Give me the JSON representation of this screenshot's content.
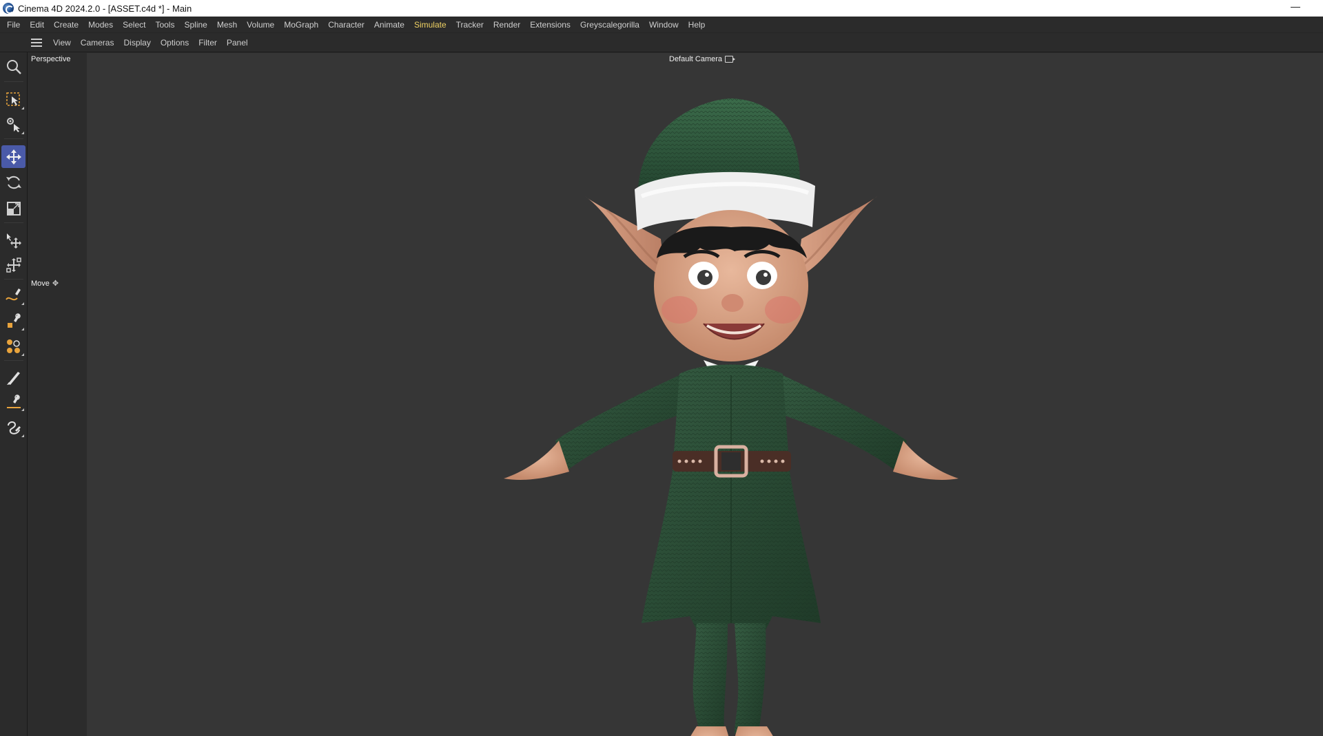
{
  "window": {
    "title": "Cinema 4D 2024.2.0 - [ASSET.c4d *] - Main",
    "minimize_symbol": "—"
  },
  "menubar": {
    "items": [
      "File",
      "Edit",
      "Create",
      "Modes",
      "Select",
      "Tools",
      "Spline",
      "Mesh",
      "Volume",
      "MoGraph",
      "Character",
      "Animate",
      "Simulate",
      "Tracker",
      "Render",
      "Extensions",
      "Greyscalegorilla",
      "Window",
      "Help"
    ],
    "highlighted": "Simulate",
    "highlight_color": "#f0d264"
  },
  "viewport_menu": {
    "items": [
      "View",
      "Cameras",
      "Display",
      "Options",
      "Filter",
      "Panel"
    ]
  },
  "toolbar": {
    "tools": [
      {
        "name": "zoom-icon",
        "active": false
      },
      {
        "name": "live-selection-icon",
        "active": false
      },
      {
        "name": "tweak-tool-icon",
        "active": false
      },
      {
        "name": "move-tool-icon",
        "active": true
      },
      {
        "name": "rotate-tool-icon",
        "active": false
      },
      {
        "name": "scale-tool-icon",
        "active": false
      },
      {
        "name": "transfer-tool-icon",
        "active": false
      },
      {
        "name": "transform-tool-icon",
        "active": false
      },
      {
        "name": "spline-pen-icon",
        "active": false
      },
      {
        "name": "spline-sketch-icon",
        "active": false
      },
      {
        "name": "mograph-cloner-icon",
        "active": false
      },
      {
        "name": "brush-icon",
        "active": false
      },
      {
        "name": "spline-smooth-icon",
        "active": false
      },
      {
        "name": "sculpt-icon",
        "active": false
      }
    ],
    "active_color": "#4a5aa8"
  },
  "viewport": {
    "projection_label": "Perspective",
    "camera_label": "Default Camera",
    "tool_label": "Move",
    "background_color": "#363636"
  },
  "scene": {
    "object": "elf character",
    "primary_colors": {
      "outfit_green": "#2a4a34",
      "skin": "#e0a88a",
      "hat_trim": "#f2f2f2",
      "belt": "#4a2e26"
    }
  }
}
